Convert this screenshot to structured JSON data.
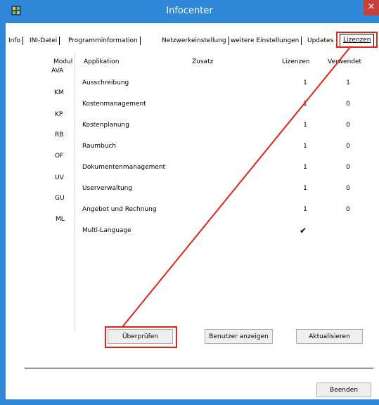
{
  "window": {
    "title": "Infocenter",
    "close_glyph": "×"
  },
  "tabs": [
    {
      "label": "Info"
    },
    {
      "label": "INI-Datei"
    },
    {
      "label": "Programminformation"
    },
    {
      "label": "Netzwerkeinstellung"
    },
    {
      "label": "weitere Einstellungen"
    },
    {
      "label": "Updates"
    },
    {
      "label": "Lizenzen",
      "active": true
    }
  ],
  "table": {
    "headers": {
      "modul": "Modul",
      "applikation": "Applikation",
      "zusatz": "Zusatz",
      "lizenzen": "Lizenzen",
      "verwendet": "Verwendet"
    },
    "rows": [
      {
        "modul": "AVA",
        "applikation": "Ausschreibung",
        "lizenzen": "1",
        "verwendet": "1"
      },
      {
        "modul": "KM",
        "applikation": "Kostenmanagement",
        "lizenzen": "1",
        "verwendet": "0"
      },
      {
        "modul": "KP",
        "applikation": "Kostenplanung",
        "lizenzen": "1",
        "verwendet": "0"
      },
      {
        "modul": "RB",
        "applikation": "Raumbuch",
        "lizenzen": "1",
        "verwendet": "0"
      },
      {
        "modul": "OF",
        "applikation": "Dokumentenmanagement",
        "lizenzen": "1",
        "verwendet": "0"
      },
      {
        "modul": "UV",
        "applikation": "Userverwaltung",
        "lizenzen": "1",
        "verwendet": "0"
      },
      {
        "modul": "GU",
        "applikation": "Angebot und Rechnung",
        "lizenzen": "1",
        "verwendet": "0"
      },
      {
        "modul": "ML",
        "applikation": "Multi-Language",
        "lizenzen": "✔",
        "verwendet": ""
      }
    ]
  },
  "buttons": {
    "check": "Überprüfen",
    "show_users": "Benutzer anzeigen",
    "refresh": "Aktualisieren",
    "exit": "Beenden"
  },
  "colors": {
    "titlebar": "#2f87d8",
    "highlight": "#e2231a"
  }
}
